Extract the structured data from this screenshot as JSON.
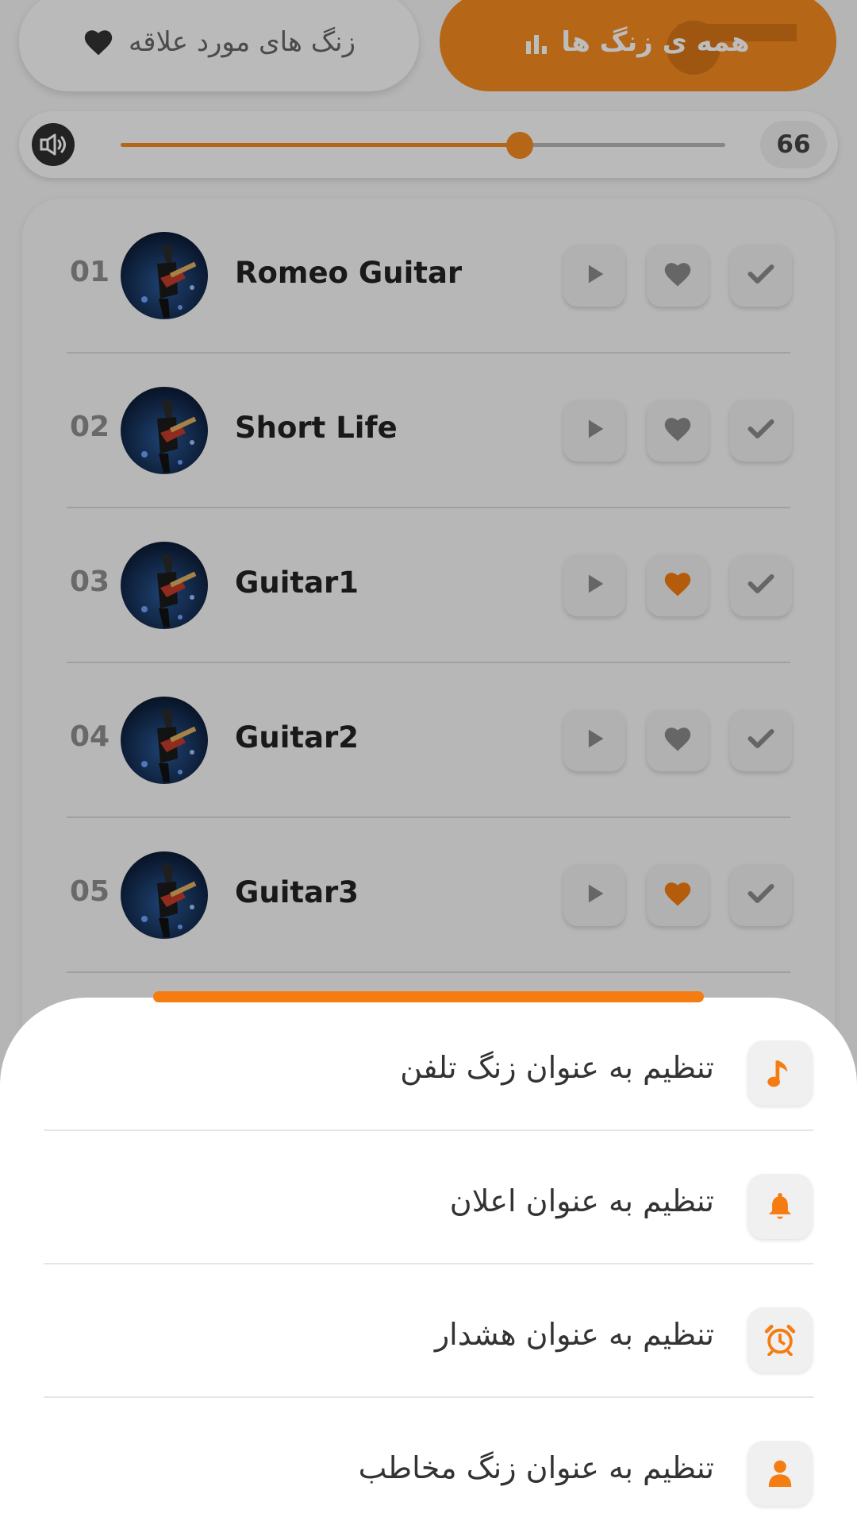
{
  "tabs": {
    "favorites_label": "زنگ های مورد علاقه",
    "all_label": "همه ی زنگ ها",
    "active": "all"
  },
  "volume": {
    "value": "66",
    "level_percent": 66
  },
  "ringtones": [
    {
      "number": "01",
      "title": "Romeo Guitar",
      "favorite": false
    },
    {
      "number": "02",
      "title": "Short Life",
      "favorite": false
    },
    {
      "number": "03",
      "title": "Guitar1",
      "favorite": true
    },
    {
      "number": "04",
      "title": "Guitar2",
      "favorite": false
    },
    {
      "number": "05",
      "title": "Guitar3",
      "favorite": true
    }
  ],
  "sheet": {
    "options": [
      {
        "label": "تنظیم به عنوان زنگ تلفن",
        "icon": "music-note-icon"
      },
      {
        "label": "تنظیم به عنوان اعلان",
        "icon": "bell-icon"
      },
      {
        "label": "تنظیم به عنوان هشدار",
        "icon": "alarm-clock-icon"
      },
      {
        "label": "تنظیم به عنوان زنگ مخاطب",
        "icon": "person-icon"
      }
    ]
  },
  "colors": {
    "accent": "#f58a1f",
    "favorite_active": "#f57c11",
    "favorite_inactive": "#8a8a8a"
  }
}
